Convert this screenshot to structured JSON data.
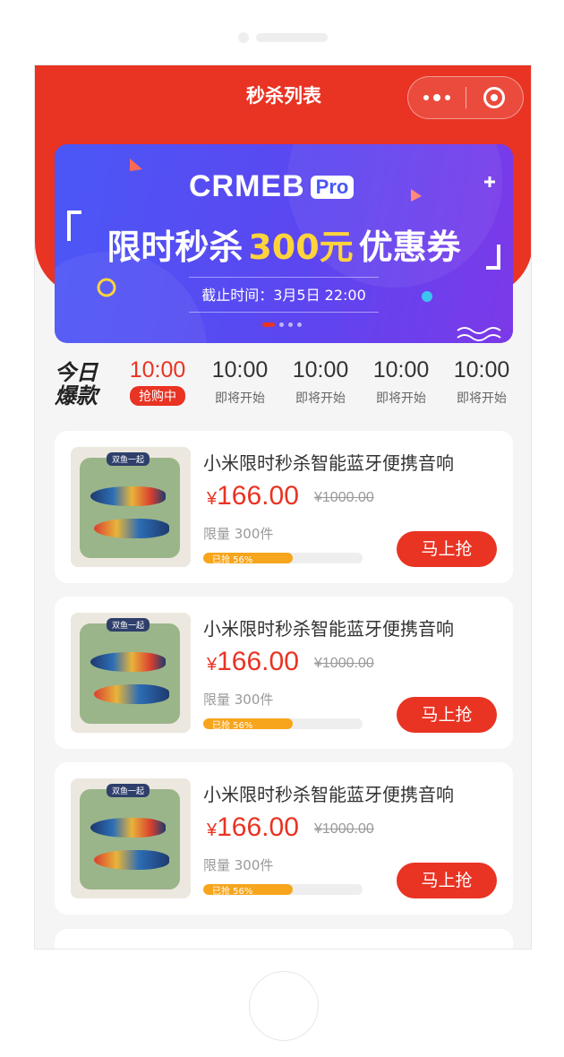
{
  "nav": {
    "title": "秒杀列表"
  },
  "banner": {
    "brand": "CRMEB",
    "brand_tag": "Pro",
    "headline_prefix": "限时秒杀",
    "headline_amount": "300元",
    "headline_suffix": "优惠券",
    "deadline": "截止时间：3月5日 22:00",
    "slide_count": 4,
    "active_slide": 1
  },
  "timebar": {
    "logo_line1": "今日",
    "logo_line2": "爆款",
    "slots": [
      {
        "time": "10:00",
        "status": "抢购中",
        "active": true
      },
      {
        "time": "10:00",
        "status": "即将开始",
        "active": false
      },
      {
        "time": "10:00",
        "status": "即将开始",
        "active": false
      },
      {
        "time": "10:00",
        "status": "即将开始",
        "active": false
      },
      {
        "time": "10:00",
        "status": "即将开始",
        "active": false
      }
    ]
  },
  "products": [
    {
      "image_tag": "双鱼一起",
      "title": "小米限时秒杀智能蓝牙便携音响",
      "currency": "¥",
      "price": "166.00",
      "original_price": "¥1000.00",
      "limit": "限量 300件",
      "progress_text": "已抢 56%",
      "progress": 0.56,
      "button": "马上抢"
    },
    {
      "image_tag": "双鱼一起",
      "title": "小米限时秒杀智能蓝牙便携音响",
      "currency": "¥",
      "price": "166.00",
      "original_price": "¥1000.00",
      "limit": "限量 300件",
      "progress_text": "已抢 56%",
      "progress": 0.56,
      "button": "马上抢"
    },
    {
      "image_tag": "双鱼一起",
      "title": "小米限时秒杀智能蓝牙便携音响",
      "currency": "¥",
      "price": "166.00",
      "original_price": "¥1000.00",
      "limit": "限量 300件",
      "progress_text": "已抢 56%",
      "progress": 0.56,
      "button": "马上抢"
    }
  ],
  "colors": {
    "primary": "#e93323",
    "progress": "#f7a51c",
    "banner": "#4b57f6",
    "highlight": "#ffd43b"
  }
}
